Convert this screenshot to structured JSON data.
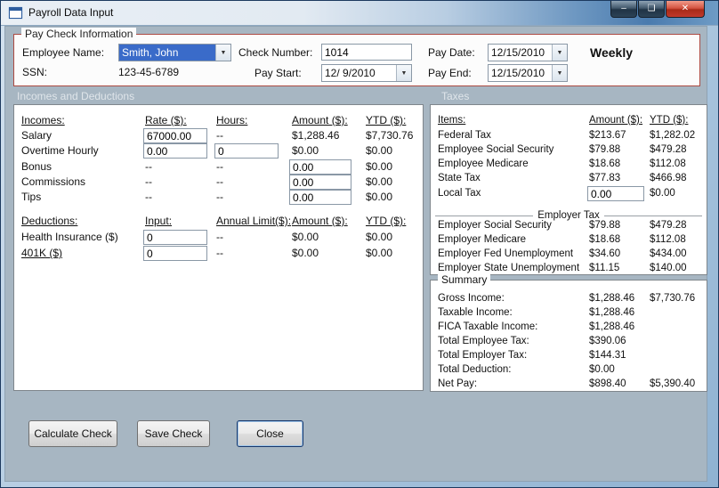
{
  "window": {
    "title": "Payroll Data Input"
  },
  "icons": {
    "dropdown": "▼",
    "minimize": "–",
    "maximize": "❏",
    "close": "✕"
  },
  "paycheck": {
    "group_label": "Pay Check Information",
    "employee_label": "Employee Name:",
    "employee_value": "Smith, John",
    "ssn_label": "SSN:",
    "ssn_value": "123-45-6789",
    "check_number_label": "Check Number:",
    "check_number_value": "1014",
    "pay_start_label": "Pay Start:",
    "pay_start_value": "12/ 9/2010",
    "pay_date_label": "Pay Date:",
    "pay_date_value": "12/15/2010",
    "pay_end_label": "Pay End:",
    "pay_end_value": "12/15/2010",
    "frequency": "Weekly"
  },
  "section_headers": {
    "left": "Incomes and Deductions",
    "right": "Taxes"
  },
  "incomes": {
    "headers": {
      "name": "Incomes:",
      "rate": "Rate ($):",
      "hours": "Hours:",
      "amount": "Amount ($):",
      "ytd": "YTD ($):"
    },
    "rows": [
      {
        "name": "Salary",
        "rate": "67000.00",
        "hours": "--",
        "amount": "$1,288.46",
        "ytd": "$7,730.76"
      },
      {
        "name": "Overtime Hourly",
        "rate": "0.00",
        "hours": "0",
        "amount": "$0.00",
        "ytd": "$0.00"
      },
      {
        "name": "Bonus",
        "rate": "--",
        "hours": "--",
        "amount": "0.00",
        "ytd": "$0.00"
      },
      {
        "name": "Commissions",
        "rate": "--",
        "hours": "--",
        "amount": "0.00",
        "ytd": "$0.00"
      },
      {
        "name": "Tips",
        "rate": "--",
        "hours": "--",
        "amount": "0.00",
        "ytd": "$0.00"
      }
    ]
  },
  "deductions": {
    "headers": {
      "name": "Deductions:",
      "input": "Input:",
      "limit": "Annual Limit($):",
      "amount": "Amount ($):",
      "ytd": "YTD ($):"
    },
    "rows": [
      {
        "name": "Health Insurance  ($)",
        "input": "0",
        "limit": "--",
        "amount": "$0.00",
        "ytd": "$0.00"
      },
      {
        "name": "401K  ($)",
        "input": "0",
        "limit": "--",
        "amount": "$0.00",
        "ytd": "$0.00"
      }
    ]
  },
  "taxes": {
    "headers": {
      "item": "Items:",
      "amount": "Amount ($):",
      "ytd": "YTD ($):"
    },
    "employee_rows": [
      {
        "item": "Federal Tax",
        "amount": "$213.67",
        "ytd": "$1,282.02"
      },
      {
        "item": "Employee Social Security",
        "amount": "$79.88",
        "ytd": "$479.28"
      },
      {
        "item": "Employee Medicare",
        "amount": "$18.68",
        "ytd": "$112.08"
      },
      {
        "item": "State Tax",
        "amount": "$77.83",
        "ytd": "$466.98"
      },
      {
        "item": "Local Tax",
        "amount": "0.00",
        "ytd": "$0.00"
      }
    ],
    "employer_label": "Employer Tax",
    "employer_rows": [
      {
        "item": "Employer Social Security",
        "amount": "$79.88",
        "ytd": "$479.28"
      },
      {
        "item": "Employer Medicare",
        "amount": "$18.68",
        "ytd": "$112.08"
      },
      {
        "item": "Employer Fed Unemployment",
        "amount": "$34.60",
        "ytd": "$434.00"
      },
      {
        "item": "Employer State Unemployment",
        "amount": "$11.15",
        "ytd": "$140.00"
      }
    ]
  },
  "summary": {
    "group_label": "Summary",
    "rows": [
      {
        "label": "Gross Income:",
        "amount": "$1,288.46",
        "ytd": "$7,730.76"
      },
      {
        "label": "Taxable Income:",
        "amount": "$1,288.46",
        "ytd": ""
      },
      {
        "label": "FICA Taxable Income:",
        "amount": "$1,288.46",
        "ytd": ""
      },
      {
        "label": "Total Employee Tax:",
        "amount": "$390.06",
        "ytd": ""
      },
      {
        "label": "Total Employer Tax:",
        "amount": "$144.31",
        "ytd": ""
      },
      {
        "label": "Total Deduction:",
        "amount": "$0.00",
        "ytd": ""
      },
      {
        "label": "Net Pay:",
        "amount": "$898.40",
        "ytd": "$5,390.40"
      }
    ]
  },
  "buttons": {
    "calculate": "Calculate Check",
    "save": "Save Check",
    "close": "Close"
  }
}
